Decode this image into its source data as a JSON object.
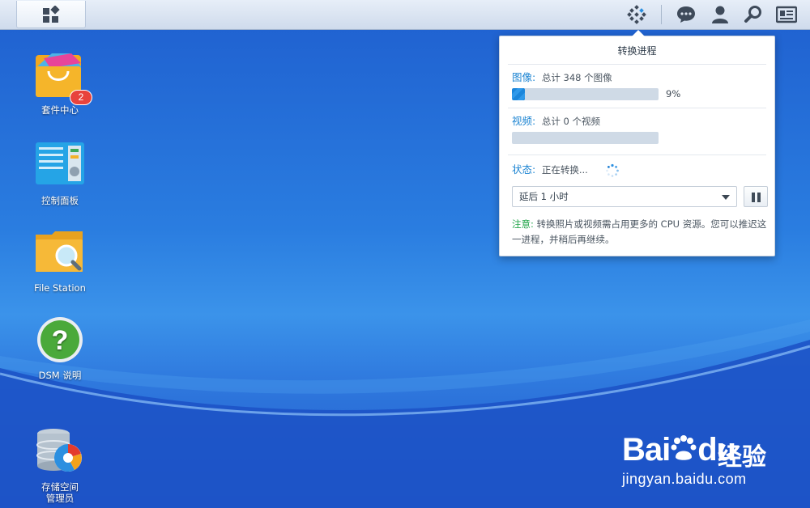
{
  "taskbar": {
    "main_menu_icon": "grid-icon",
    "indexing_icon": "indexing-status-icon",
    "icons": [
      "chat-icon",
      "user-icon",
      "search-icon",
      "widgets-icon"
    ]
  },
  "desktop": {
    "items": [
      {
        "label": "套件中心",
        "icon": "package-center-icon",
        "badge": "2"
      },
      {
        "label": "控制面板",
        "icon": "control-panel-icon"
      },
      {
        "label": "File Station",
        "icon": "file-station-icon"
      },
      {
        "label": "DSM 说明",
        "icon": "help-icon"
      },
      {
        "label": "存储空间\n管理员",
        "icon": "storage-manager-icon"
      }
    ]
  },
  "panel": {
    "title": "转换进程",
    "images": {
      "label": "图像:",
      "summary": "总计 348 个图像",
      "progress": 0.09,
      "percent": "9%"
    },
    "videos": {
      "label": "视频:",
      "summary": "总计 0 个视频",
      "progress": 0
    },
    "status": {
      "label": "状态:",
      "text": "正在转换..."
    },
    "delay_select": {
      "value": "延后 1 小时"
    },
    "note": {
      "label": "注意:",
      "text": "转换照片或视频需占用更多的 CPU 资源。您可以推迟这一进程，并稍后再继续。"
    }
  },
  "watermark": {
    "logo_a": "Bai",
    "logo_b": "du",
    "logo_cn": "经验",
    "url": "jingyan.baidu.com"
  },
  "colors": {
    "accent": "#1c84d2",
    "note_green": "#22a54a",
    "badge_red": "#e8433c"
  }
}
